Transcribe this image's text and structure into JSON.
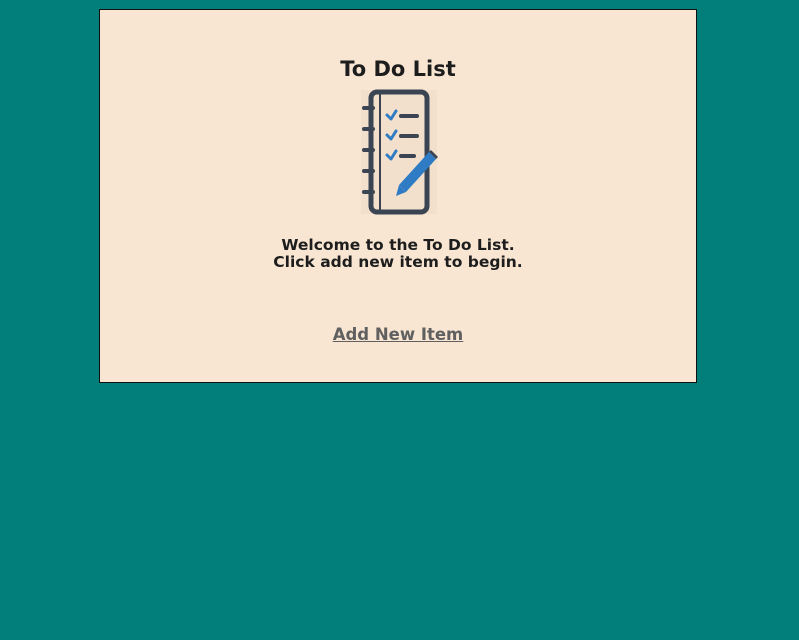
{
  "app": {
    "title": "To Do List",
    "welcome_line1": "Welcome to the To Do List.",
    "welcome_line2": "Click add new item to begin.",
    "add_link_label": "Add New Item",
    "logo_icon": "notebook-checklist-pencil-icon"
  },
  "colors": {
    "page_background": "#037f7b",
    "card_background": "#f8e6d2",
    "card_border": "#111111",
    "text": "#1d1d1d",
    "link": "#606060",
    "icon_dark": "#3a4452",
    "icon_accent": "#2f7cc4"
  }
}
